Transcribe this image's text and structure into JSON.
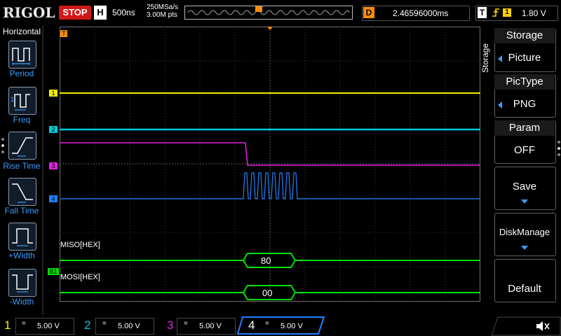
{
  "topbar": {
    "logo": "RIGOL",
    "run_state": "STOP",
    "h_badge": "H",
    "timebase": "500ns",
    "sample_rate": "250MSa/s",
    "memory_depth": "3.00M pts",
    "delay_badge": "D",
    "delay": "2.46596000ms",
    "trigger_badge": "T",
    "trigger_channel": "1",
    "trigger_level": "1.80 V"
  },
  "left_menu": {
    "title": "Horizontal",
    "items": [
      {
        "label": "Period",
        "icon": "period-icon"
      },
      {
        "label": "Freq",
        "icon": "frequency-icon"
      },
      {
        "label": "Rise Time",
        "icon": "rise-time-icon"
      },
      {
        "label": "Fall Time",
        "icon": "fall-time-icon"
      },
      {
        "label": "+Width",
        "icon": "positive-width-icon"
      },
      {
        "label": "-Width",
        "icon": "negative-width-icon"
      }
    ]
  },
  "waveform": {
    "trigger_marker": "T",
    "channel_markers": [
      "1",
      "2",
      "3",
      "4",
      "B1"
    ],
    "decode": {
      "miso_label": "MISO[HEX]",
      "miso_value": "80",
      "mosi_label": "MOSI[HEX]",
      "mosi_value": "00"
    }
  },
  "right_menu": {
    "side_label": "Storage",
    "title": "Storage",
    "storage_label": "Picture",
    "pictype_title": "PicType",
    "pictype_value": "PNG",
    "param_title": "Param",
    "param_value": "OFF",
    "save_label": "Save",
    "diskmanage_label": "DiskManage",
    "default_label": "Default"
  },
  "channels": [
    {
      "num": "1",
      "coupling": "=",
      "scale": "5.00 V",
      "color": "#f0f000"
    },
    {
      "num": "2",
      "coupling": "=",
      "scale": "5.00 V",
      "color": "#00c8d8"
    },
    {
      "num": "3",
      "coupling": "=",
      "scale": "5.00 V",
      "color": "#e020e0"
    },
    {
      "num": "4",
      "coupling": "=",
      "scale": "5.00 V",
      "color": "#2080ff"
    }
  ],
  "colors": {
    "ch1": "#f0f000",
    "ch2": "#00c8d8",
    "ch3": "#e020e0",
    "ch4": "#2080ff",
    "decode": "#00e000",
    "trigger": "#ff8c00"
  }
}
